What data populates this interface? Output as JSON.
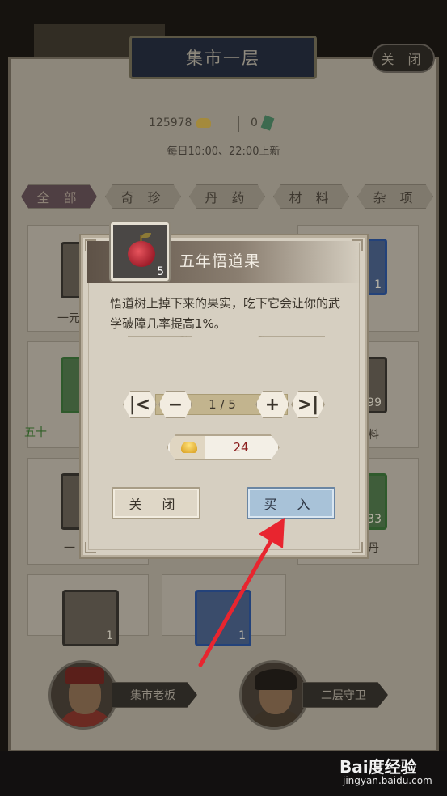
{
  "market": {
    "title": "集市一层",
    "close_label": "关 闭",
    "gold_amount": "125978",
    "jade_amount": "0",
    "refresh_note": "每日10:00、22:00上新",
    "tabs": [
      "全 部",
      "奇 珍",
      "丹 药",
      "材 料",
      "杂 项"
    ],
    "active_tab": 0,
    "cells": [
      {
        "label": "一元",
        "count": ""
      },
      {
        "label": "",
        "count": "1"
      },
      {
        "label": "五十",
        "count": ""
      },
      {
        "label": "料",
        "count": "399"
      },
      {
        "label": "一",
        "count": ""
      },
      {
        "label": "丹",
        "count": "33"
      },
      {
        "label": "",
        "count": "1"
      },
      {
        "label": "",
        "count": "1"
      }
    ]
  },
  "npcs": [
    {
      "label": "集市老板"
    },
    {
      "label": "二层守卫"
    }
  ],
  "dialog": {
    "item_name": "五年悟道果",
    "item_stock": "5",
    "description": "悟道树上掉下来的果实，吃下它会让你的武学破障几率提高1%。",
    "quantity": "1 / 5",
    "btn_first": "|<",
    "btn_minus": "−",
    "btn_plus": "+",
    "btn_last": ">|",
    "price": "24",
    "close_label": "关 闭",
    "buy_label": "买 入"
  },
  "watermark": {
    "brand": "Bai度经验",
    "url": "jingyan.baidu.com"
  },
  "icons": {
    "gold": "gold-ingot-icon",
    "jade": "jade-icon",
    "fruit": "fruit-icon",
    "arrow": "red-arrow-annotation"
  },
  "colors": {
    "buy_button": "#a8c2d8",
    "price_text": "#8b1d1d",
    "arrow": "#e8252f"
  }
}
